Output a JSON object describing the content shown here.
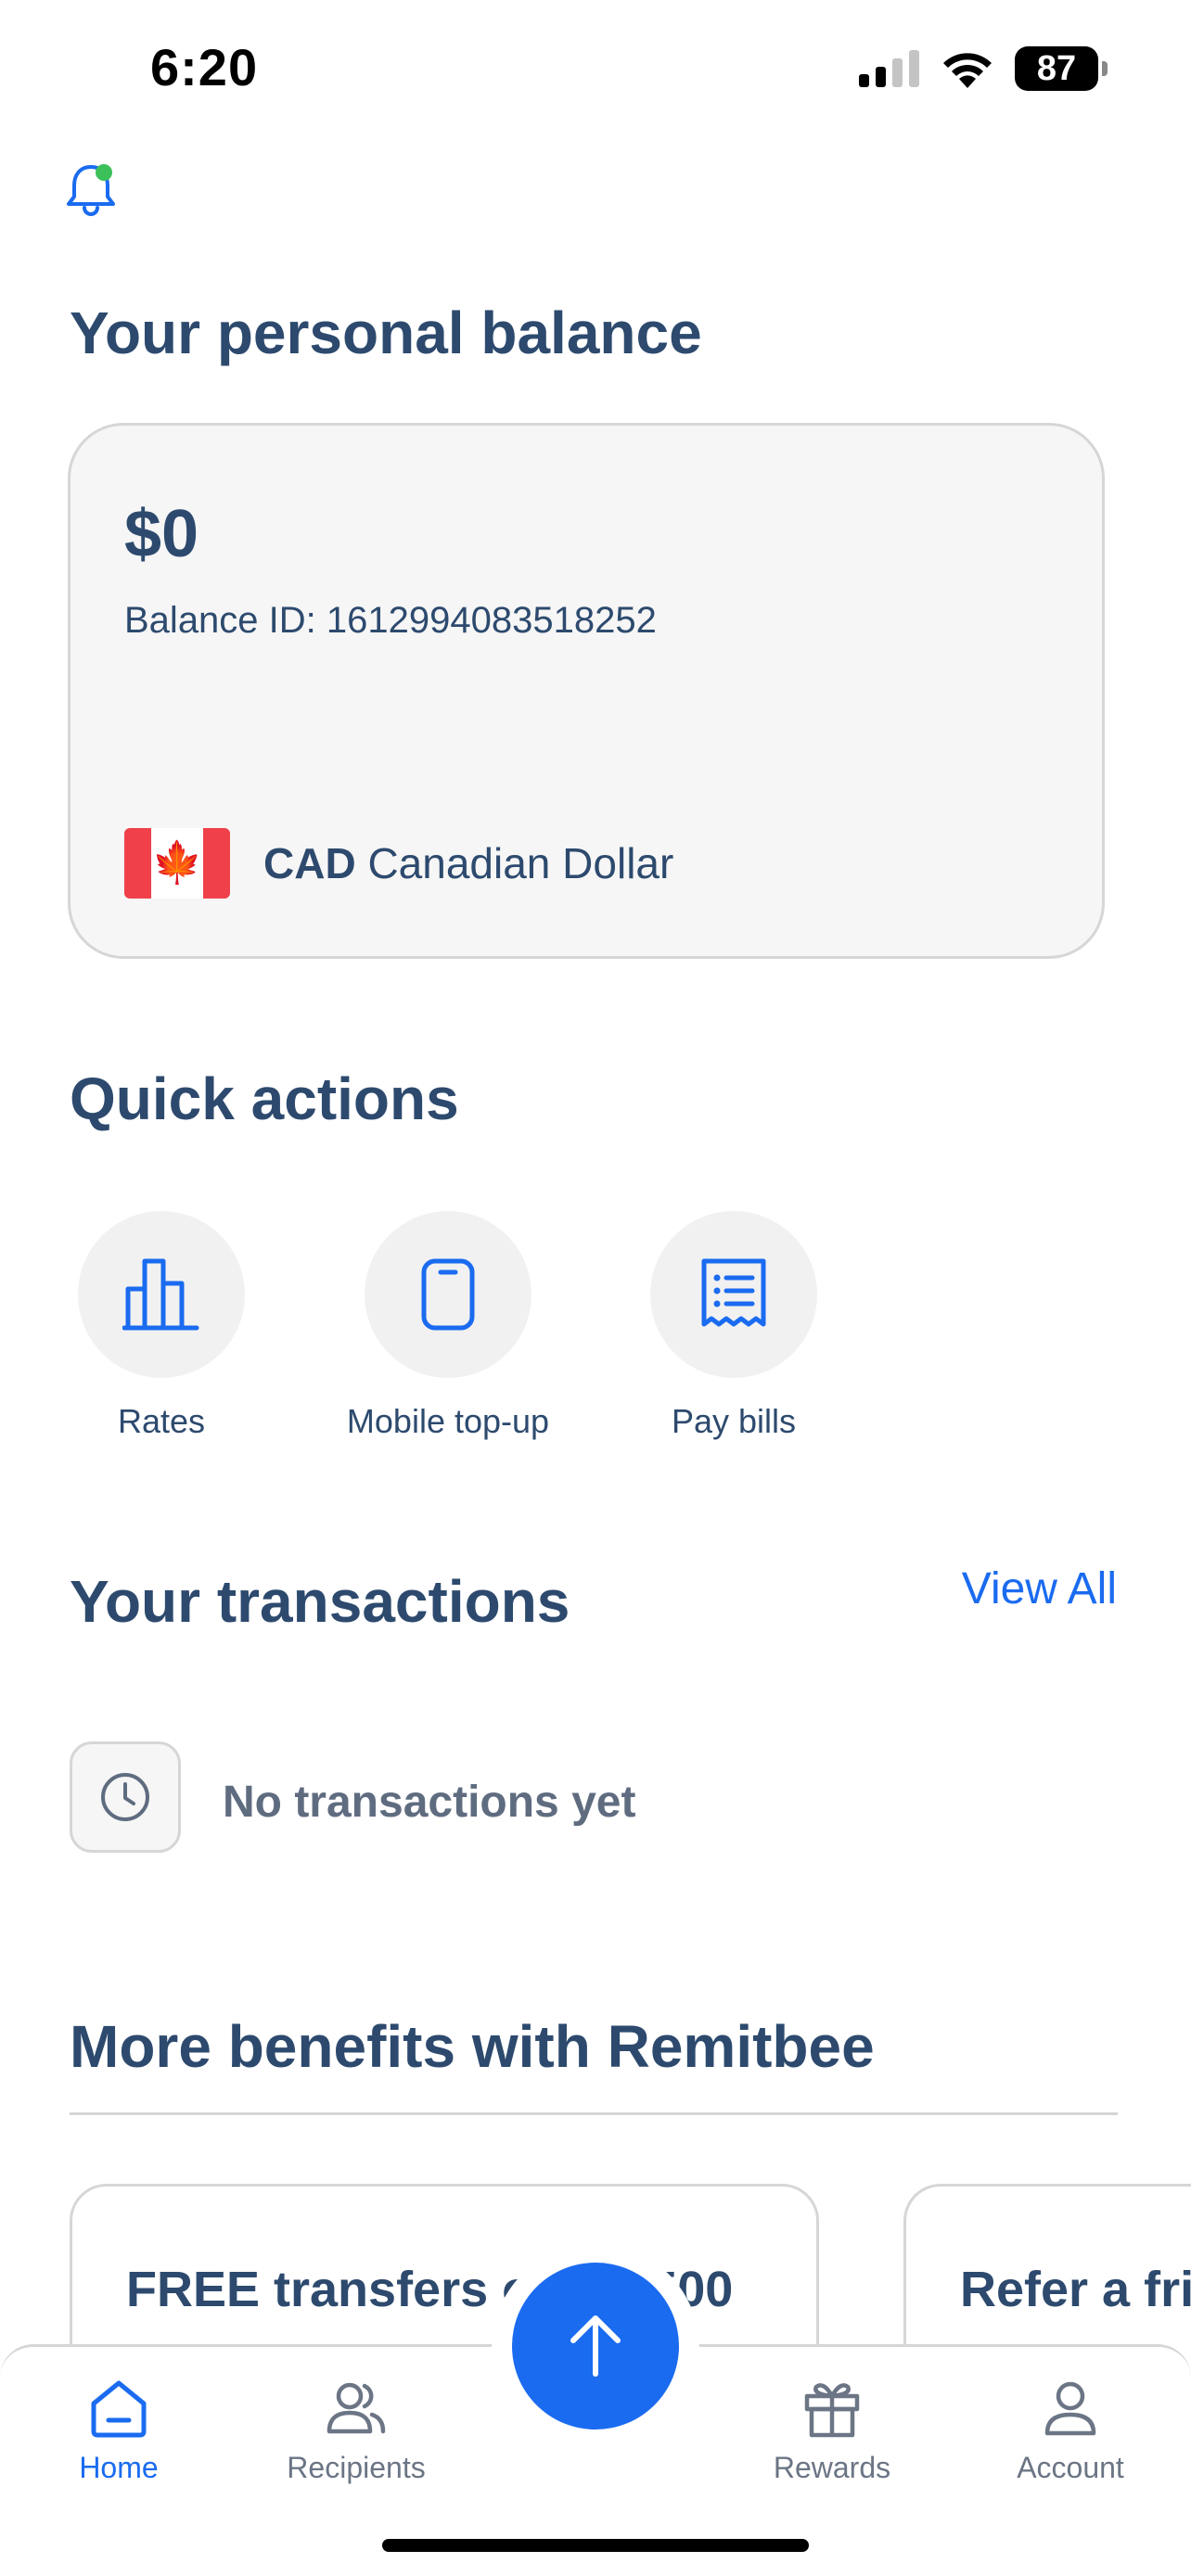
{
  "status_bar": {
    "time": "6:20",
    "battery": "87"
  },
  "balance_section": {
    "title": "Your personal balance",
    "amount": "$0",
    "balance_id": "Balance ID: 1612994083518252",
    "currency_code": "CAD",
    "currency_name": "Canadian Dollar",
    "flag_icon": "canada-flag-icon"
  },
  "quick_actions": {
    "title": "Quick actions",
    "items": [
      {
        "label": "Rates",
        "icon": "bar-chart-icon"
      },
      {
        "label": "Mobile top-up",
        "icon": "phone-icon"
      },
      {
        "label": "Pay bills",
        "icon": "receipt-icon"
      }
    ]
  },
  "transactions": {
    "title": "Your transactions",
    "view_all": "View All",
    "empty_text": "No transactions yet",
    "empty_icon": "clock-icon"
  },
  "benefits": {
    "title": "More benefits with Remitbee",
    "cards": [
      {
        "title": "FREE transfers over $500"
      },
      {
        "title": "Refer a friend"
      }
    ]
  },
  "bottom_nav": {
    "items": [
      {
        "label": "Home",
        "icon": "home-icon",
        "active": true
      },
      {
        "label": "Recipients",
        "icon": "users-icon",
        "active": false
      },
      {
        "label": "Rewards",
        "icon": "gift-icon",
        "active": false
      },
      {
        "label": "Account",
        "icon": "user-icon",
        "active": false
      }
    ],
    "send_button_icon": "arrow-up-icon"
  },
  "colors": {
    "primary_blue": "#1a6bf0",
    "heading_navy": "#2d4a6e",
    "muted_gray": "#6b7585",
    "notification_dot": "#3cc05a",
    "flag_red": "#f0404a"
  }
}
